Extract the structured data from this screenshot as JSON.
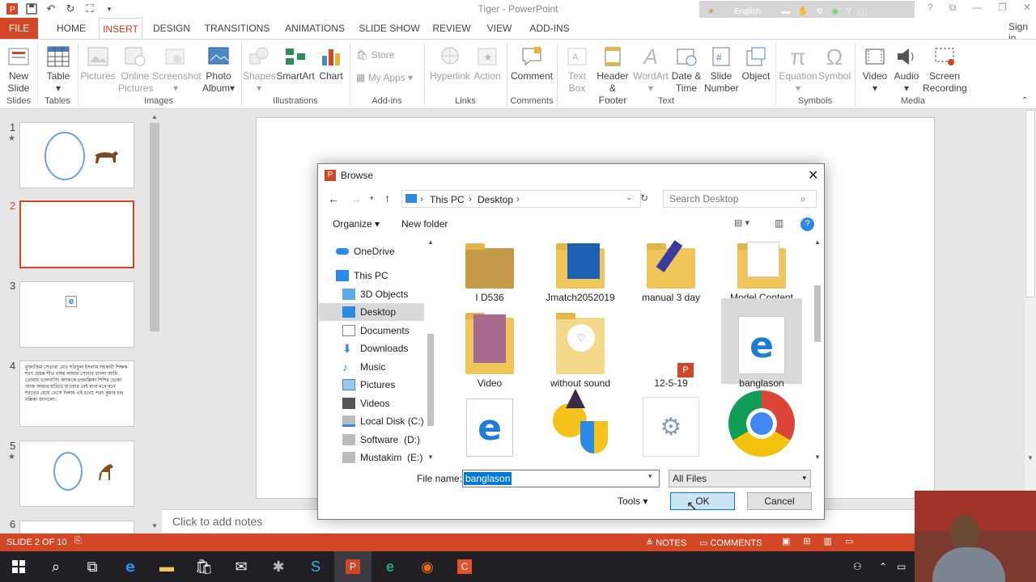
{
  "app": {
    "title": "Tiger - PowerPoint"
  },
  "qat": {
    "icons": [
      "app-logo-icon",
      "save-icon",
      "undo-icon",
      "redo-icon",
      "present-from-start-icon",
      "customize-icon"
    ]
  },
  "account": {
    "language": "English",
    "sign_in": "Sign in"
  },
  "tabs": [
    "FILE",
    "HOME",
    "INSERT",
    "DESIGN",
    "TRANSITIONS",
    "ANIMATIONS",
    "SLIDE SHOW",
    "REVIEW",
    "VIEW",
    "ADD-INS"
  ],
  "ribbon": {
    "new_slide": [
      "New",
      "Slide"
    ],
    "table": "Table",
    "pictures": "Pictures",
    "online_pictures": [
      "Online",
      "Pictures"
    ],
    "screenshot": "Screenshot",
    "photo_album": [
      "Photo",
      "Album"
    ],
    "shapes": "Shapes",
    "smartart": "SmartArt",
    "chart": "Chart",
    "store": "Store",
    "my_apps": "My Apps",
    "hyperlink": "Hyperlink",
    "action": "Action",
    "comment": "Comment",
    "text_box": [
      "Text",
      "Box"
    ],
    "header_footer": [
      "Header",
      "& Footer"
    ],
    "wordart": "WordArt",
    "date_time": [
      "Date &",
      "Time"
    ],
    "slide_number": [
      "Slide",
      "Number"
    ],
    "object": "Object",
    "equation": "Equation",
    "symbol": "Symbol",
    "video": "Video",
    "audio": "Audio",
    "screen_recording": [
      "Screen",
      "Recording"
    ],
    "groups": [
      "Slides",
      "Tables",
      "Images",
      "Illustrations",
      "Add-ins",
      "Links",
      "Comments",
      "Text",
      "Symbols",
      "Media"
    ]
  },
  "thumbnails": {
    "slide_numbers": [
      "1",
      "2",
      "3",
      "4",
      "5",
      "6"
    ],
    "slide4_text": "মুক্তাজিম সেতারা মোঃ শরিফুল ইসলাম সহকারী শিক্ষক শরৎ হেমন্ত শীত বসন্ত আমার সোনার বাংলা আমি তোমায় ভালবাসি। আজকে চন্দ্রমল্লিকা শিশির ভেজা আজ আমার হারিয়ে যাওয়ার নেই মানা মনে মনে শরতের মেঘে ভেসে দিলাম এই ডানা, শরৎ কুমার চন্দ্র মল্লিকা জাগলো।"
  },
  "notes": {
    "placeholder": "Click to add notes"
  },
  "status": {
    "slide_info": "SLIDE 2 OF 10",
    "notes": "NOTES",
    "comments": "COMMENTS"
  },
  "dialog": {
    "title": "Browse",
    "breadcrumb": [
      "This PC",
      "Desktop"
    ],
    "search_placeholder": "Search Desktop",
    "organize": "Organize",
    "new_folder": "New folder",
    "nav": [
      "OneDrive",
      "This PC",
      "3D Objects",
      "Desktop",
      "Documents",
      "Downloads",
      "Music",
      "Pictures",
      "Videos",
      "Local Disk (C:)",
      "Software  (D:)",
      "Mustakim  (E:)"
    ],
    "files": [
      {
        "name": "I D536",
        "kind": "folder-photo"
      },
      {
        "name": "Jmatch2052019",
        "kind": "folder-win"
      },
      {
        "name": "manual 3 day",
        "kind": "folder-pen"
      },
      {
        "name": "Model Content",
        "kind": "folder-doc"
      },
      {
        "name": "Video",
        "kind": "folder-photo2"
      },
      {
        "name": "without sound",
        "kind": "folder-heart"
      },
      {
        "name": "12-5-19",
        "kind": "pptx"
      },
      {
        "name": "banglason",
        "kind": "edge-selected"
      },
      {
        "name": "",
        "kind": "edge"
      },
      {
        "name": "",
        "kind": "shield-smiley"
      },
      {
        "name": "",
        "kind": "tool"
      },
      {
        "name": "",
        "kind": "chrome"
      }
    ],
    "file_name_label": "File name:",
    "file_name_value": "banglason",
    "file_type": "All Files",
    "tools": "Tools",
    "ok": "OK",
    "cancel": "Cancel"
  },
  "colors": {
    "accent": "#d24726",
    "ribbon_active": "#c43e1c",
    "taskbar": "#1f1f24",
    "folder": "#f0c65a"
  }
}
